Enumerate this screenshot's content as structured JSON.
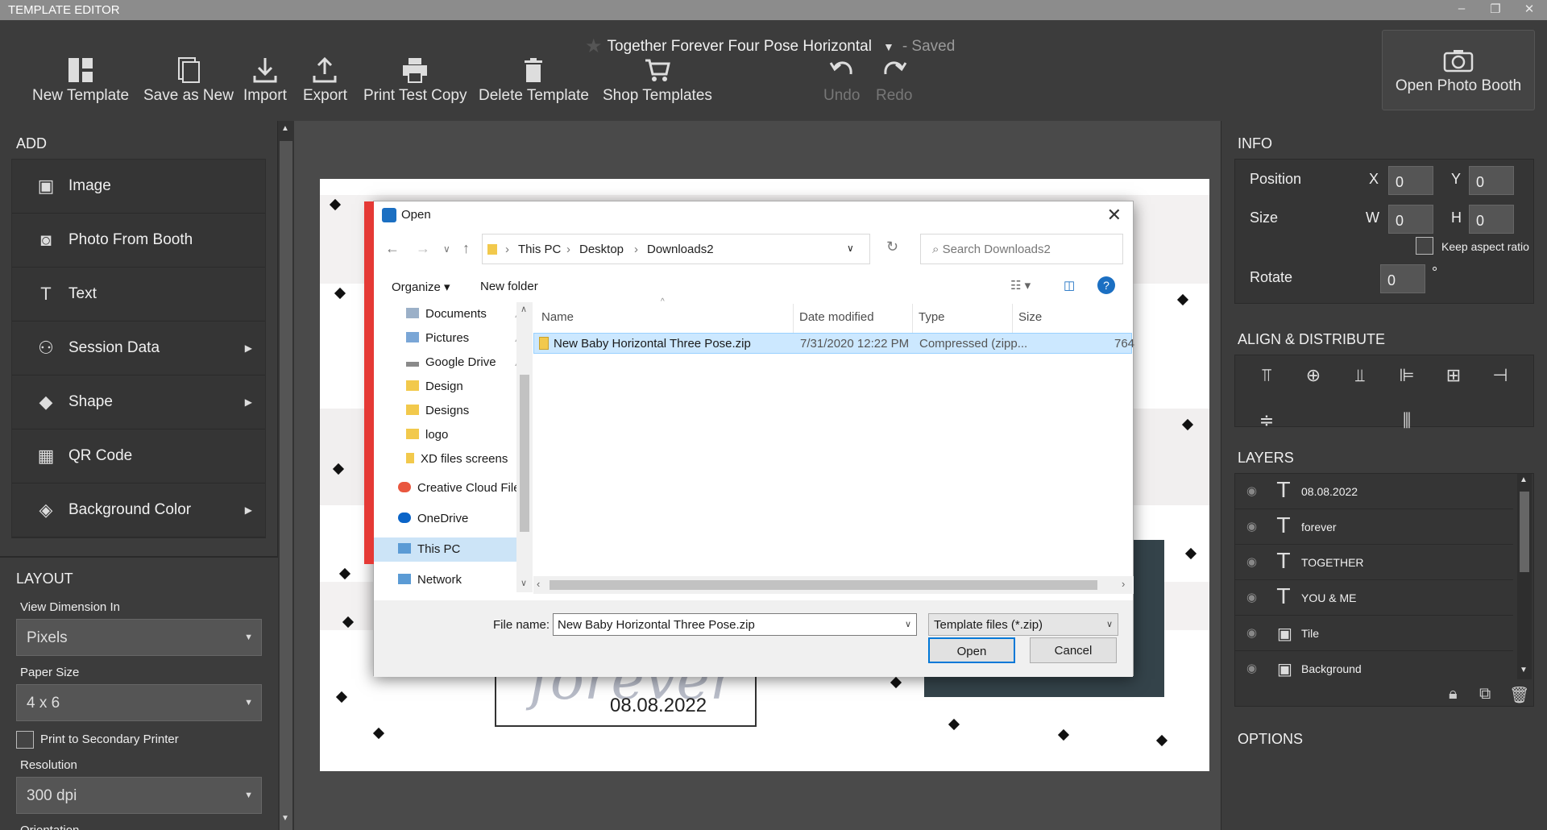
{
  "app": {
    "title": "TEMPLATE EDITOR",
    "window_controls": [
      "–",
      "❐",
      "✕"
    ]
  },
  "document": {
    "title": "Together Forever Four Pose Horizontal",
    "status": "- Saved"
  },
  "toolbar": {
    "buttons": [
      {
        "label": "New Template",
        "icon": "new-template-icon"
      },
      {
        "label": "Save as New",
        "icon": "save-as-new-icon"
      },
      {
        "label": "Import",
        "icon": "import-icon"
      },
      {
        "label": "Export",
        "icon": "export-icon"
      },
      {
        "label": "Print Test Copy",
        "icon": "printer-icon"
      },
      {
        "label": "Delete Template",
        "icon": "trash-icon"
      },
      {
        "label": "Shop Templates",
        "icon": "cart-icon"
      },
      {
        "label": "Undo",
        "icon": "undo-icon",
        "disabled": true
      },
      {
        "label": "Redo",
        "icon": "redo-icon",
        "disabled": true
      }
    ],
    "photo_booth": "Open Photo Booth"
  },
  "left": {
    "add_heading": "ADD",
    "add_items": [
      {
        "label": "Image",
        "icon": "image-icon",
        "glyph": "▣"
      },
      {
        "label": "Photo From Booth",
        "icon": "camera-icon",
        "glyph": "◙"
      },
      {
        "label": "Text",
        "icon": "text-icon",
        "glyph": "T"
      },
      {
        "label": "Session Data",
        "icon": "people-icon",
        "glyph": "⚇",
        "arrow": "▶"
      },
      {
        "label": "Shape",
        "icon": "shape-icon",
        "glyph": "◆",
        "arrow": "▶"
      },
      {
        "label": "QR Code",
        "icon": "qr-icon",
        "glyph": "▦"
      },
      {
        "label": "Background Color",
        "icon": "paint-bucket-icon",
        "glyph": "◈",
        "arrow": "▶"
      }
    ],
    "layout_heading": "LAYOUT",
    "view_dimension_label": "View Dimension In",
    "view_dimension_value": "Pixels",
    "paper_size_label": "Paper Size",
    "paper_size_value": "4 x 6",
    "secondary_printer_label": "Print to Secondary Printer",
    "resolution_label": "Resolution",
    "resolution_value": "300 dpi",
    "orientation_label": "Orientation"
  },
  "canvas": {
    "date_text": "08.08.2022",
    "script_text": "forever",
    "band_colors": [
      "#a6cf4e",
      "#5fbcc1",
      "#34434a"
    ]
  },
  "right": {
    "info_heading": "INFO",
    "position_label": "Position",
    "x_label": "X",
    "x_value": "0",
    "y_label": "Y",
    "y_value": "0",
    "size_label": "Size",
    "w_label": "W",
    "w_value": "0",
    "h_label": "H",
    "h_value": "0",
    "keep_aspect_label": "Keep aspect ratio",
    "rotate_label": "Rotate",
    "rotate_value": "0",
    "rotate_unit": "°",
    "align_heading": "ALIGN & DISTRIBUTE",
    "layers_heading": "LAYERS",
    "layers": [
      {
        "name": "08.08.2022",
        "type": "text"
      },
      {
        "name": "forever",
        "type": "text"
      },
      {
        "name": "TOGETHER",
        "type": "text"
      },
      {
        "name": "YOU & ME",
        "type": "text"
      },
      {
        "name": "Tile",
        "type": "image"
      },
      {
        "name": "Background",
        "type": "image"
      }
    ],
    "options_heading": "OPTIONS"
  },
  "dialog": {
    "title": "Open",
    "breadcrumb": [
      "This PC",
      "Desktop",
      "Downloads2"
    ],
    "search_placeholder": "Search Downloads2",
    "organize": "Organize ▾",
    "new_folder": "New folder",
    "nav_items": [
      {
        "label": "Documents",
        "pinned": true
      },
      {
        "label": "Pictures",
        "pinned": true
      },
      {
        "label": "Google Drive",
        "pinned": true
      },
      {
        "label": "Design"
      },
      {
        "label": "Designs"
      },
      {
        "label": "logo"
      },
      {
        "label": "XD files screens"
      },
      {
        "label": "Creative Cloud Files"
      },
      {
        "label": "OneDrive"
      },
      {
        "label": "This PC",
        "selected": true
      },
      {
        "label": "Network"
      }
    ],
    "columns": [
      "Name",
      "Date modified",
      "Type",
      "Size"
    ],
    "files": [
      {
        "name": "New Baby Horizontal Three Pose.zip",
        "date": "7/31/2020 12:22 PM",
        "type": "Compressed (zipp...",
        "size": "764"
      }
    ],
    "file_name_label": "File name:",
    "file_name_value": "New Baby Horizontal Three Pose.zip",
    "file_type_value": "Template files (*.zip)",
    "open_button": "Open",
    "cancel_button": "Cancel"
  }
}
